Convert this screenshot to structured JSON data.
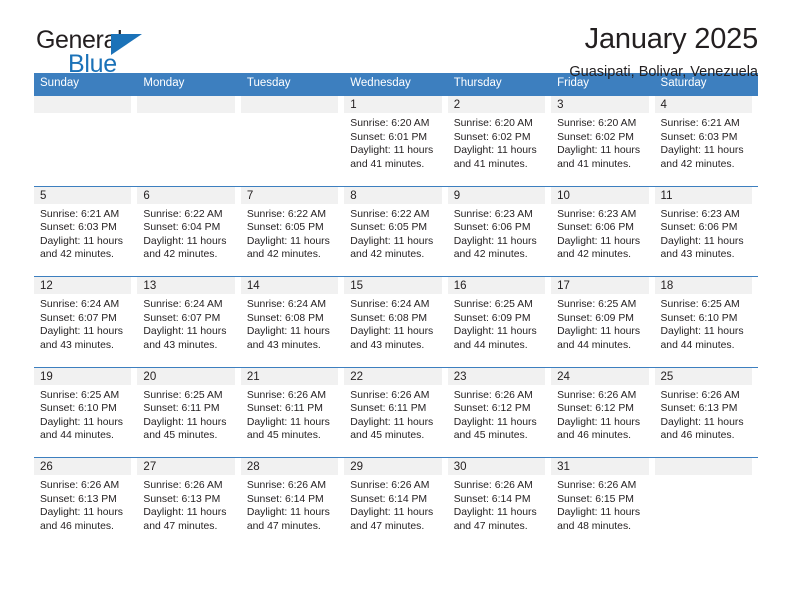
{
  "brand": {
    "name_part1": "General",
    "name_part2": "Blue",
    "triangle_color": "#1b72b8"
  },
  "header": {
    "title": "January 2025",
    "subtitle": "Guasipati, Bolivar, Venezuela"
  },
  "theme": {
    "header_blue": "#3d7fbf",
    "daynum_gray": "#f1f1f1",
    "text": "#231f20"
  },
  "weekdays": [
    "Sunday",
    "Monday",
    "Tuesday",
    "Wednesday",
    "Thursday",
    "Friday",
    "Saturday"
  ],
  "weeks": [
    [
      {
        "day": "",
        "empty": true
      },
      {
        "day": "",
        "empty": true
      },
      {
        "day": "",
        "empty": true
      },
      {
        "day": "1",
        "sunrise": "Sunrise: 6:20 AM",
        "sunset": "Sunset: 6:01 PM",
        "daylight_line1": "Daylight: 11 hours",
        "daylight_line2": "and 41 minutes."
      },
      {
        "day": "2",
        "sunrise": "Sunrise: 6:20 AM",
        "sunset": "Sunset: 6:02 PM",
        "daylight_line1": "Daylight: 11 hours",
        "daylight_line2": "and 41 minutes."
      },
      {
        "day": "3",
        "sunrise": "Sunrise: 6:20 AM",
        "sunset": "Sunset: 6:02 PM",
        "daylight_line1": "Daylight: 11 hours",
        "daylight_line2": "and 41 minutes."
      },
      {
        "day": "4",
        "sunrise": "Sunrise: 6:21 AM",
        "sunset": "Sunset: 6:03 PM",
        "daylight_line1": "Daylight: 11 hours",
        "daylight_line2": "and 42 minutes."
      }
    ],
    [
      {
        "day": "5",
        "sunrise": "Sunrise: 6:21 AM",
        "sunset": "Sunset: 6:03 PM",
        "daylight_line1": "Daylight: 11 hours",
        "daylight_line2": "and 42 minutes."
      },
      {
        "day": "6",
        "sunrise": "Sunrise: 6:22 AM",
        "sunset": "Sunset: 6:04 PM",
        "daylight_line1": "Daylight: 11 hours",
        "daylight_line2": "and 42 minutes."
      },
      {
        "day": "7",
        "sunrise": "Sunrise: 6:22 AM",
        "sunset": "Sunset: 6:05 PM",
        "daylight_line1": "Daylight: 11 hours",
        "daylight_line2": "and 42 minutes."
      },
      {
        "day": "8",
        "sunrise": "Sunrise: 6:22 AM",
        "sunset": "Sunset: 6:05 PM",
        "daylight_line1": "Daylight: 11 hours",
        "daylight_line2": "and 42 minutes."
      },
      {
        "day": "9",
        "sunrise": "Sunrise: 6:23 AM",
        "sunset": "Sunset: 6:06 PM",
        "daylight_line1": "Daylight: 11 hours",
        "daylight_line2": "and 42 minutes."
      },
      {
        "day": "10",
        "sunrise": "Sunrise: 6:23 AM",
        "sunset": "Sunset: 6:06 PM",
        "daylight_line1": "Daylight: 11 hours",
        "daylight_line2": "and 42 minutes."
      },
      {
        "day": "11",
        "sunrise": "Sunrise: 6:23 AM",
        "sunset": "Sunset: 6:06 PM",
        "daylight_line1": "Daylight: 11 hours",
        "daylight_line2": "and 43 minutes."
      }
    ],
    [
      {
        "day": "12",
        "sunrise": "Sunrise: 6:24 AM",
        "sunset": "Sunset: 6:07 PM",
        "daylight_line1": "Daylight: 11 hours",
        "daylight_line2": "and 43 minutes."
      },
      {
        "day": "13",
        "sunrise": "Sunrise: 6:24 AM",
        "sunset": "Sunset: 6:07 PM",
        "daylight_line1": "Daylight: 11 hours",
        "daylight_line2": "and 43 minutes."
      },
      {
        "day": "14",
        "sunrise": "Sunrise: 6:24 AM",
        "sunset": "Sunset: 6:08 PM",
        "daylight_line1": "Daylight: 11 hours",
        "daylight_line2": "and 43 minutes."
      },
      {
        "day": "15",
        "sunrise": "Sunrise: 6:24 AM",
        "sunset": "Sunset: 6:08 PM",
        "daylight_line1": "Daylight: 11 hours",
        "daylight_line2": "and 43 minutes."
      },
      {
        "day": "16",
        "sunrise": "Sunrise: 6:25 AM",
        "sunset": "Sunset: 6:09 PM",
        "daylight_line1": "Daylight: 11 hours",
        "daylight_line2": "and 44 minutes."
      },
      {
        "day": "17",
        "sunrise": "Sunrise: 6:25 AM",
        "sunset": "Sunset: 6:09 PM",
        "daylight_line1": "Daylight: 11 hours",
        "daylight_line2": "and 44 minutes."
      },
      {
        "day": "18",
        "sunrise": "Sunrise: 6:25 AM",
        "sunset": "Sunset: 6:10 PM",
        "daylight_line1": "Daylight: 11 hours",
        "daylight_line2": "and 44 minutes."
      }
    ],
    [
      {
        "day": "19",
        "sunrise": "Sunrise: 6:25 AM",
        "sunset": "Sunset: 6:10 PM",
        "daylight_line1": "Daylight: 11 hours",
        "daylight_line2": "and 44 minutes."
      },
      {
        "day": "20",
        "sunrise": "Sunrise: 6:25 AM",
        "sunset": "Sunset: 6:11 PM",
        "daylight_line1": "Daylight: 11 hours",
        "daylight_line2": "and 45 minutes."
      },
      {
        "day": "21",
        "sunrise": "Sunrise: 6:26 AM",
        "sunset": "Sunset: 6:11 PM",
        "daylight_line1": "Daylight: 11 hours",
        "daylight_line2": "and 45 minutes."
      },
      {
        "day": "22",
        "sunrise": "Sunrise: 6:26 AM",
        "sunset": "Sunset: 6:11 PM",
        "daylight_line1": "Daylight: 11 hours",
        "daylight_line2": "and 45 minutes."
      },
      {
        "day": "23",
        "sunrise": "Sunrise: 6:26 AM",
        "sunset": "Sunset: 6:12 PM",
        "daylight_line1": "Daylight: 11 hours",
        "daylight_line2": "and 45 minutes."
      },
      {
        "day": "24",
        "sunrise": "Sunrise: 6:26 AM",
        "sunset": "Sunset: 6:12 PM",
        "daylight_line1": "Daylight: 11 hours",
        "daylight_line2": "and 46 minutes."
      },
      {
        "day": "25",
        "sunrise": "Sunrise: 6:26 AM",
        "sunset": "Sunset: 6:13 PM",
        "daylight_line1": "Daylight: 11 hours",
        "daylight_line2": "and 46 minutes."
      }
    ],
    [
      {
        "day": "26",
        "sunrise": "Sunrise: 6:26 AM",
        "sunset": "Sunset: 6:13 PM",
        "daylight_line1": "Daylight: 11 hours",
        "daylight_line2": "and 46 minutes."
      },
      {
        "day": "27",
        "sunrise": "Sunrise: 6:26 AM",
        "sunset": "Sunset: 6:13 PM",
        "daylight_line1": "Daylight: 11 hours",
        "daylight_line2": "and 47 minutes."
      },
      {
        "day": "28",
        "sunrise": "Sunrise: 6:26 AM",
        "sunset": "Sunset: 6:14 PM",
        "daylight_line1": "Daylight: 11 hours",
        "daylight_line2": "and 47 minutes."
      },
      {
        "day": "29",
        "sunrise": "Sunrise: 6:26 AM",
        "sunset": "Sunset: 6:14 PM",
        "daylight_line1": "Daylight: 11 hours",
        "daylight_line2": "and 47 minutes."
      },
      {
        "day": "30",
        "sunrise": "Sunrise: 6:26 AM",
        "sunset": "Sunset: 6:14 PM",
        "daylight_line1": "Daylight: 11 hours",
        "daylight_line2": "and 47 minutes."
      },
      {
        "day": "31",
        "sunrise": "Sunrise: 6:26 AM",
        "sunset": "Sunset: 6:15 PM",
        "daylight_line1": "Daylight: 11 hours",
        "daylight_line2": "and 48 minutes."
      },
      {
        "day": "",
        "empty": true
      }
    ]
  ]
}
